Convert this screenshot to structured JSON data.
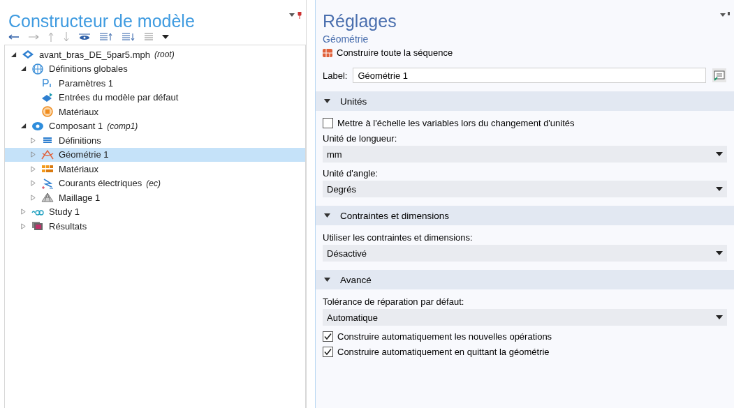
{
  "model_builder": {
    "title": "Constructeur de modèle",
    "tree": [
      {
        "kind": "model",
        "label": "avant_bras_DE_5par5.mph",
        "tag": "(root)",
        "expanded": true,
        "selected": false,
        "children": [
          {
            "kind": "globe",
            "label": "Définitions globales",
            "expanded": true,
            "selected": false,
            "children": [
              {
                "kind": "param",
                "label": "Paramètres 1",
                "selected": false
              },
              {
                "kind": "inputs",
                "label": "Entrées du modèle par défaut",
                "selected": false
              },
              {
                "kind": "material-ring",
                "label": "Matériaux",
                "selected": false
              }
            ]
          },
          {
            "kind": "component",
            "label": "Composant 1",
            "tag": "(comp1)",
            "expanded": true,
            "selected": false,
            "children": [
              {
                "kind": "definitions",
                "label": "Définitions",
                "expanded": false,
                "selected": false
              },
              {
                "kind": "geometry",
                "label": "Géométrie 1",
                "expanded": false,
                "selected": true
              },
              {
                "kind": "materials",
                "label": "Matériaux",
                "expanded": false,
                "selected": false
              },
              {
                "kind": "physics",
                "label": "Courants électriques",
                "tag": "(ec)",
                "expanded": false,
                "selected": false
              },
              {
                "kind": "mesh",
                "label": "Maillage 1",
                "expanded": false,
                "selected": false
              }
            ]
          },
          {
            "kind": "study",
            "label": "Study 1",
            "expanded": false,
            "selected": false
          },
          {
            "kind": "results",
            "label": "Résultats",
            "expanded": false,
            "selected": false
          }
        ]
      }
    ]
  },
  "settings": {
    "title": "Réglages",
    "subtitle": "Géométrie",
    "build_action": "Construire toute la séquence",
    "label_caption": "Label:",
    "label_value": "Géométrie 1",
    "sections": [
      {
        "title": "Unités",
        "expanded": true,
        "items": [
          {
            "kind": "checkbox",
            "label": "Mettre à l'échelle les variables lors du changement d'unités",
            "checked": false
          },
          {
            "kind": "select",
            "label": "Unité de longueur:",
            "value": "mm"
          },
          {
            "kind": "select",
            "label": "Unité d'angle:",
            "value": "Degrés"
          }
        ]
      },
      {
        "title": "Contraintes et dimensions",
        "expanded": true,
        "items": [
          {
            "kind": "select",
            "label": "Utiliser les contraintes et dimensions:",
            "value": "Désactivé"
          }
        ]
      },
      {
        "title": "Avancé",
        "expanded": true,
        "items": [
          {
            "kind": "select",
            "label": "Tolérance de réparation par défaut:",
            "value": "Automatique"
          },
          {
            "kind": "checkbox",
            "label": "Construire automatiquement les nouvelles opérations",
            "checked": true
          },
          {
            "kind": "checkbox",
            "label": "Construire automatiquement en quittant la géométrie",
            "checked": true
          }
        ]
      }
    ]
  }
}
